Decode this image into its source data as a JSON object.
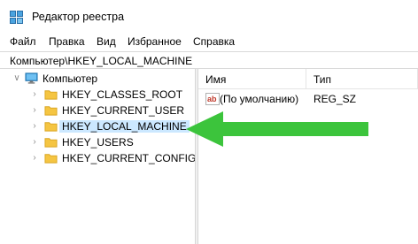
{
  "window": {
    "title": "Редактор реестра",
    "icon": "registry-editor-icon"
  },
  "menu": {
    "items": [
      {
        "label": "Файл"
      },
      {
        "label": "Правка"
      },
      {
        "label": "Вид"
      },
      {
        "label": "Избранное"
      },
      {
        "label": "Справка"
      }
    ]
  },
  "address": {
    "path": "Компьютер\\HKEY_LOCAL_MACHINE"
  },
  "tree": {
    "root": {
      "label": "Компьютер",
      "icon": "computer-icon",
      "expanded": true
    },
    "items": [
      {
        "label": "HKEY_CLASSES_ROOT",
        "selected": false
      },
      {
        "label": "HKEY_CURRENT_USER",
        "selected": false
      },
      {
        "label": "HKEY_LOCAL_MACHINE",
        "selected": true
      },
      {
        "label": "HKEY_USERS",
        "selected": false
      },
      {
        "label": "HKEY_CURRENT_CONFIG",
        "selected": false
      }
    ]
  },
  "list": {
    "columns": [
      {
        "label": "Имя"
      },
      {
        "label": "Тип"
      }
    ],
    "rows": [
      {
        "name": "(По умолчанию)",
        "type": "REG_SZ",
        "icon": "string-value-icon"
      }
    ]
  },
  "colors": {
    "arrow": "#3cc43c",
    "selection": "#cce8ff",
    "folder": "#f5c542"
  }
}
